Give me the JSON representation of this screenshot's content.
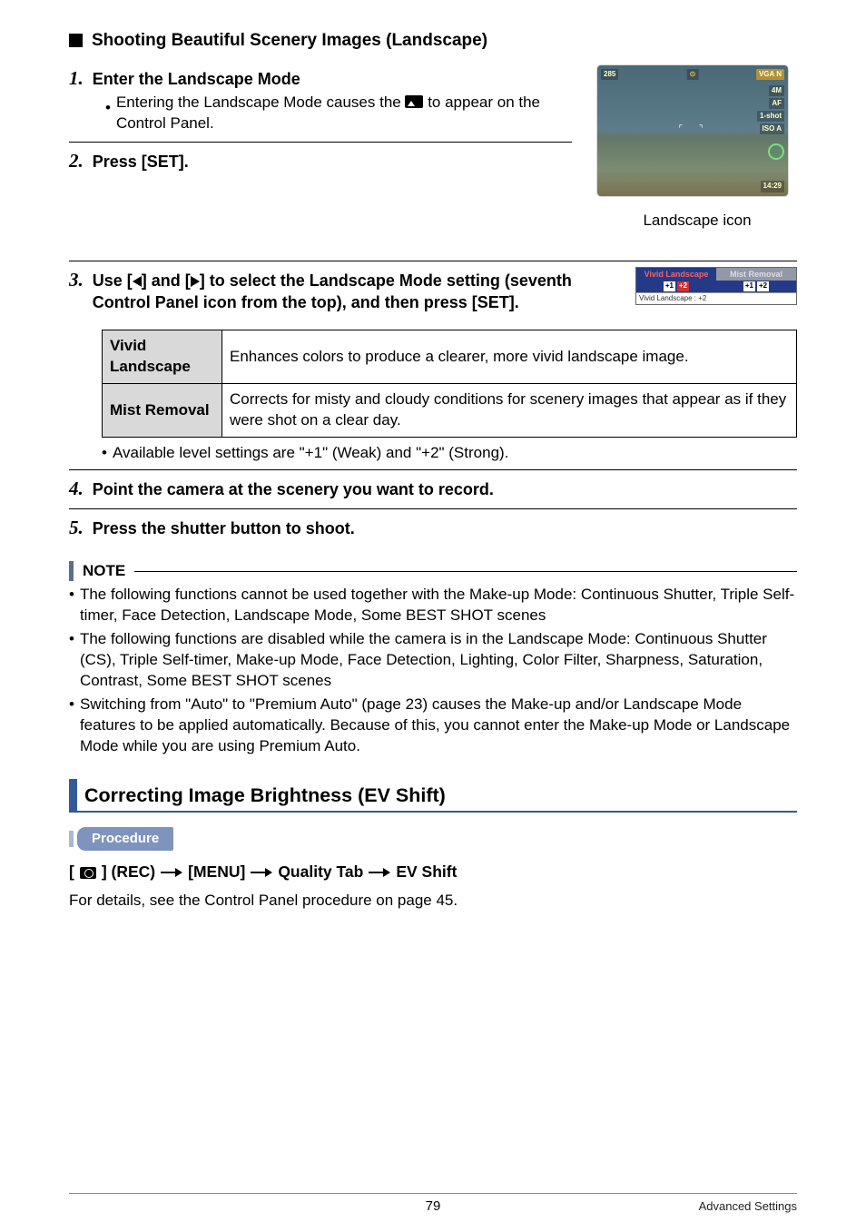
{
  "header": {
    "title": "Shooting Beautiful Scenery Images (Landscape)"
  },
  "steps": {
    "s1": {
      "num": "1.",
      "title": "Enter the Landscape Mode",
      "body_pre": "Entering the Landscape Mode causes the ",
      "body_post": " to appear on the Control Panel."
    },
    "s2": {
      "num": "2.",
      "title": "Press [SET]."
    },
    "s3": {
      "num": "3.",
      "title_pre": "Use [",
      "title_mid": "] and [",
      "title_post": "] to select the Landscape Mode setting (seventh Control Panel icon from the top), and then press [SET]."
    },
    "s4": {
      "num": "4.",
      "title": "Point the camera at the scenery you want to record."
    },
    "s5": {
      "num": "5.",
      "title": "Press the shutter button to shoot."
    }
  },
  "preview": {
    "top_left": "285",
    "top_mid": "⊙",
    "top_right": "VGA N",
    "right_labels": [
      "4M",
      "AF",
      "1-shot",
      "ISO A"
    ],
    "bottom_right_time": "14:29",
    "caption": "Landscape icon"
  },
  "option_strip": {
    "head1": "Vivid Landscape",
    "head2": "Mist Removal",
    "lvl_a1": "+1",
    "lvl_a2": "+2",
    "lvl_b1": "+1",
    "lvl_b2": "+2",
    "status": "Vivid Landscape : +2"
  },
  "modes_table": {
    "r1_label": "Vivid Landscape",
    "r1_desc": "Enhances colors to produce a clearer, more vivid landscape image.",
    "r2_label": "Mist Removal",
    "r2_desc": "Corrects for misty and cloudy conditions for scenery images that appear as if they were shot on a clear day."
  },
  "levels_note": "Available level settings are \"+1\" (Weak) and \"+2\" (Strong).",
  "note": {
    "label": "NOTE",
    "items": [
      "The following functions cannot be used together with the Make-up Mode: Continuous Shutter, Triple Self-timer, Face Detection, Landscape Mode, Some BEST SHOT scenes",
      "The following functions are disabled while the camera is in the Landscape Mode: Continuous Shutter (CS), Triple Self-timer, Make-up Mode, Face Detection, Lighting, Color Filter, Sharpness, Saturation, Contrast, Some BEST SHOT scenes",
      "Switching from \"Auto\" to \"Premium Auto\" (page 23) causes the Make-up and/or Landscape Mode features to be applied automatically. Because of this, you cannot enter the Make-up Mode or Landscape Mode while you are using Premium Auto."
    ]
  },
  "blue_section": {
    "title": "Correcting Image Brightness (EV Shift)"
  },
  "procedure": {
    "pill": "Procedure",
    "p1": "[",
    "p2": "] (REC)",
    "p3": "[MENU]",
    "p4": "Quality Tab",
    "p5": "EV Shift",
    "detail": "For details, see the Control Panel procedure on page 45."
  },
  "footer": {
    "page": "79",
    "section": "Advanced Settings"
  }
}
